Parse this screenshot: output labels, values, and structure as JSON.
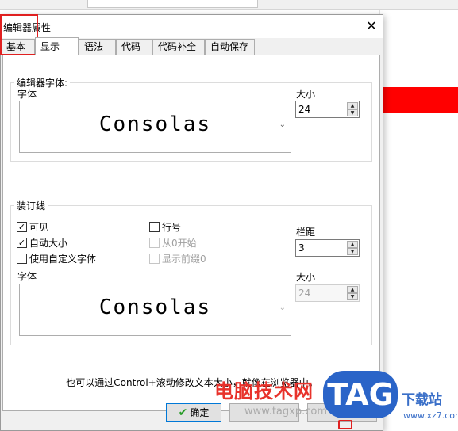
{
  "dialog": {
    "title": "编辑器属性",
    "close_glyph": "✕"
  },
  "tabs": [
    {
      "label": "基本",
      "active": false
    },
    {
      "label": "显示",
      "active": true
    },
    {
      "label": "语法",
      "active": false
    },
    {
      "label": "代码",
      "active": false
    },
    {
      "label": "代码补全",
      "active": false
    },
    {
      "label": "自动保存",
      "active": false
    }
  ],
  "editor_font": {
    "group_label": "编辑器字体:",
    "font_label": "字体",
    "font_value": "Consolas",
    "size_label": "大小",
    "size_value": "24"
  },
  "gutter": {
    "group_label": "装订线",
    "checkboxes": {
      "visible": {
        "label": "可见",
        "checked": true,
        "enabled": true
      },
      "auto_size": {
        "label": "自动大小",
        "checked": true,
        "enabled": true
      },
      "custom_font": {
        "label": "使用自定义字体",
        "checked": false,
        "enabled": true
      },
      "line_numbers": {
        "label": "行号",
        "checked": false,
        "enabled": true
      },
      "start_from_zero": {
        "label": "从0开始",
        "checked": false,
        "enabled": false
      },
      "show_leading_zeros": {
        "label": "显示前缀0",
        "checked": false,
        "enabled": false
      }
    },
    "spacing_label": "栏距",
    "spacing_value": "3",
    "font_label": "字体",
    "font_value": "Consolas",
    "size_label": "大小",
    "size_value": "24"
  },
  "hint": "也可以通过Control+滚动修改文本大小，就像在浏览器中。",
  "buttons": {
    "ok_label": "确定",
    "ok_glyph": "✔"
  },
  "watermark": {
    "site_name": "电脑技术网",
    "url": "www.tagxp.com",
    "logo_text": "TAG",
    "download_label": "下载站",
    "download_url": "www.xz7.com"
  },
  "colors": {
    "annotation": "#e02020",
    "background_highlight": "#ff0000",
    "watermark_red": "#e8322b",
    "watermark_blue": "#2a64c8"
  }
}
